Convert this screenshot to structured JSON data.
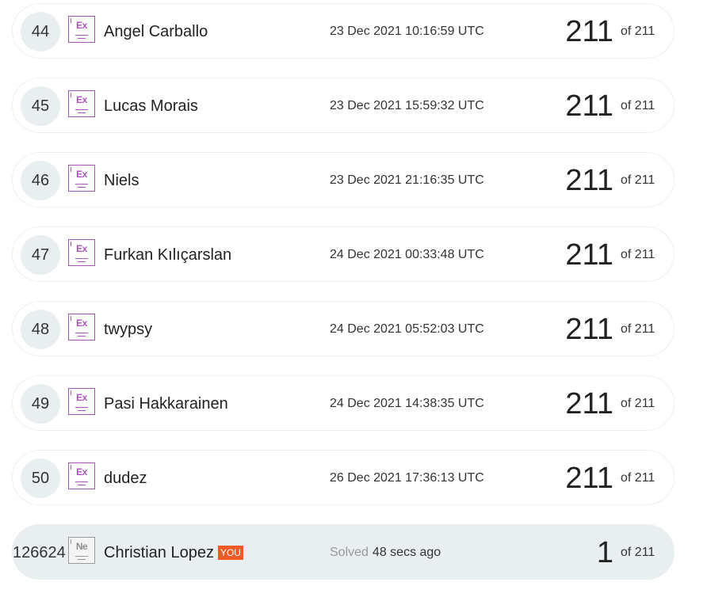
{
  "rows": [
    {
      "rank": "44",
      "badge": "Ex",
      "name": "Angel Carballo",
      "date": "23 Dec 2021 10:16:59 UTC",
      "score": "211",
      "of": "of 211"
    },
    {
      "rank": "45",
      "badge": "Ex",
      "name": "Lucas Morais",
      "date": "23 Dec 2021 15:59:32 UTC",
      "score": "211",
      "of": "of 211"
    },
    {
      "rank": "46",
      "badge": "Ex",
      "name": "Niels",
      "date": "23 Dec 2021 21:16:35 UTC",
      "score": "211",
      "of": "of 211"
    },
    {
      "rank": "47",
      "badge": "Ex",
      "name": "Furkan Kılıçarslan",
      "date": "24 Dec 2021 00:33:48 UTC",
      "score": "211",
      "of": "of 211"
    },
    {
      "rank": "48",
      "badge": "Ex",
      "name": "twypsy",
      "date": "24 Dec 2021 05:52:03 UTC",
      "score": "211",
      "of": "of 211"
    },
    {
      "rank": "49",
      "badge": "Ex",
      "name": "Pasi Hakkarainen",
      "date": "24 Dec 2021 14:38:35 UTC",
      "score": "211",
      "of": "of 211"
    },
    {
      "rank": "50",
      "badge": "Ex",
      "name": "dudez",
      "date": "26 Dec 2021 17:36:13 UTC",
      "score": "211",
      "of": "of 211"
    }
  ],
  "current_user": {
    "rank": "126624",
    "badge": "Ne",
    "name": "Christian Lopez",
    "you_tag": "YOU",
    "solved_label": "Solved",
    "solved_time": "48 secs ago",
    "score": "1",
    "of": "of 211"
  },
  "colors": {
    "badge_expert": "#a855b7",
    "badge_neutral": "#9a9a9a",
    "you_tag": "#f15a24",
    "current_row_bg": "#e9eef0"
  }
}
